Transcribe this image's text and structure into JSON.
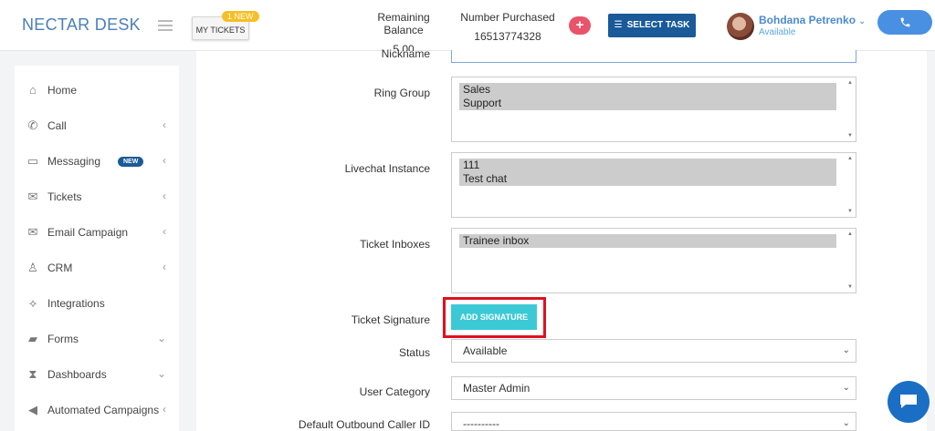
{
  "header": {
    "logo": "NECTAR DESK",
    "my_tickets_label": "MY TICKETS",
    "new_badge": "1 NEW",
    "balance_label": "Remaining Balance",
    "balance_value": "5.00",
    "purchased_label": "Number Purchased",
    "purchased_value": "16513774328",
    "select_task_label": "SELECT TASK",
    "user_name": "Bohdana Petrenko",
    "user_status": "Available"
  },
  "sidebar": {
    "items": [
      {
        "label": "Home",
        "icon": "home-icon",
        "has_chevron": false
      },
      {
        "label": "Call",
        "icon": "phone-icon",
        "has_chevron": true
      },
      {
        "label": "Messaging",
        "icon": "message-icon",
        "has_chevron": true,
        "badge": "NEW"
      },
      {
        "label": "Tickets",
        "icon": "envelope-icon",
        "has_chevron": true
      },
      {
        "label": "Email Campaign",
        "icon": "envelope-icon",
        "has_chevron": true
      },
      {
        "label": "CRM",
        "icon": "user-icon",
        "has_chevron": true
      },
      {
        "label": "Integrations",
        "icon": "puzzle-icon",
        "has_chevron": false
      },
      {
        "label": "Forms",
        "icon": "folder-icon",
        "has_chevron": true
      },
      {
        "label": "Dashboards",
        "icon": "hourglass-icon",
        "has_chevron": true
      },
      {
        "label": "Automated Campaigns",
        "icon": "megaphone-icon",
        "has_chevron": true
      }
    ]
  },
  "form": {
    "nickname_label": "Nickname",
    "ring_group_label": "Ring Group",
    "ring_group_options": [
      "Sales",
      "Support"
    ],
    "livechat_label": "Livechat Instance",
    "livechat_options": [
      "111",
      "Test chat"
    ],
    "ticket_inboxes_label": "Ticket Inboxes",
    "ticket_inboxes_options": [
      "Trainee inbox"
    ],
    "ticket_signature_label": "Ticket Signature",
    "add_signature_label": "ADD SIGNATURE",
    "status_label": "Status",
    "status_value": "Available",
    "user_category_label": "User Category",
    "user_category_value": "Master Admin",
    "caller_id_label": "Default Outbound Caller ID",
    "caller_id_value": "----------"
  },
  "colors": {
    "brand_blue": "#4a7fb8",
    "select_task_bg": "#1a5a99",
    "add_signature_bg": "#3cc9d6",
    "highlight_red": "#e01020",
    "call_button": "#4a90e2"
  }
}
